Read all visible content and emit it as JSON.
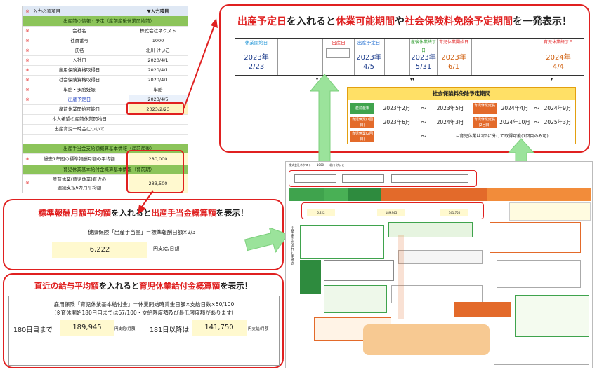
{
  "form": {
    "header": {
      "mark": "※",
      "label": "入力必須項目",
      "value": "▼入力項目"
    },
    "section1": "出産前の情報・予定（産前産後休業開始前）",
    "rows": [
      {
        "mark": "※",
        "label": "会社名",
        "value": "株式会社ネクスト"
      },
      {
        "mark": "※",
        "label": "社員番号",
        "value": "1000"
      },
      {
        "mark": "※",
        "label": "氏名",
        "value": "北川 けいこ"
      },
      {
        "mark": "※",
        "label": "入社日",
        "value": "2020/4/1"
      },
      {
        "mark": "※",
        "label": "雇用保険資格取得日",
        "value": "2020/4/1"
      },
      {
        "mark": "※",
        "label": "社会保険資格取得日",
        "value": "2020/4/1"
      },
      {
        "mark": "※",
        "label": "単胎・多胎妊娠",
        "value": "単胎"
      },
      {
        "mark": "※",
        "label": "出産予定日",
        "value": "2023/4/5"
      },
      {
        "mark": "",
        "label": "産前休業開始可能日",
        "value": "2023/2/23"
      },
      {
        "mark": "",
        "label": "本人希望の産前休業開始日",
        "value": ""
      },
      {
        "mark": "",
        "label": "出産育児一時金について",
        "value": ""
      }
    ],
    "section2": "出産手当金支給額概算基本情報（産前産後）",
    "row_std": {
      "mark": "※",
      "label": "過去1年間の標準報酬月額の平均額",
      "value": "280,000"
    },
    "section3": "育児休業基本給付金概算基本情報（育前期）",
    "row_wage": {
      "mark": "※",
      "label": "産前休業(育児休業)直近の\n連続支払6カ月平均額",
      "value": "283,500"
    }
  },
  "top_panel": {
    "title_red1": "出産予定日",
    "title_blk1": "を入れると",
    "title_red2": "休業可能期間",
    "title_blk2": "や",
    "title_red3": "社会保険料免除予定期間",
    "title_blk3": "を一発表示！",
    "cells": [
      {
        "head": "休業開始日",
        "year": "2023年",
        "date": "2/23"
      },
      {
        "head": "出産日",
        "year": "",
        "date": ""
      },
      {
        "head": "出産予定日",
        "year": "2023年",
        "date": "4/5"
      },
      {
        "head": "産後休業終了日",
        "year": "2023年",
        "date": "5/31"
      },
      {
        "head": "育児休業開始日",
        "year": "2023年",
        "date": "6/1"
      },
      {
        "head": "育児休業終了日",
        "year": "2024年",
        "date": "4/4"
      }
    ]
  },
  "social": {
    "title": "社会保険料免除予定期間",
    "rows": [
      {
        "tag": "産前産後",
        "from": "2023年2月",
        "tilde": "～",
        "to": "2023年5月",
        "tag2": "育児休業延長",
        "from2": "2024年4月",
        "tilde2": "～",
        "to2": "2024年9月"
      },
      {
        "tag": "育児休業(1回目)",
        "from": "2023年6月",
        "tilde": "～",
        "to": "2024年3月",
        "tag2": "育児休業延長(2回目)",
        "from2": "2024年10月",
        "tilde2": "～",
        "to2": "2025年3月"
      },
      {
        "tag": "育児休業(2回目)",
        "from": "",
        "tilde": "～",
        "note": "←育児休業は2回に分けて取得可能(1回目のみ可)"
      }
    ]
  },
  "left1": {
    "title_red1": "標準報酬月額平均額",
    "title_blk1": "を入れると",
    "title_red2": "出産手当金概算額",
    "title_blk2": "を表示！",
    "formula": "健康保険「出産手当金」＝標準報酬日額×2/3",
    "value": "6,222",
    "unit": "円支給/日額"
  },
  "left2": {
    "title_red1": "直近の給与平均額",
    "title_blk1": "を入れると",
    "title_red2": "育児休業給付金概算額",
    "title_blk2": "を表示！",
    "formula1": "雇用保険「育児休業基本給付金」＝休業開始時賃金日額×支給日数×50/100",
    "formula2": "（※育休開始180日目までは67/100・支給限度額及び最低限度額があります）",
    "label1": "180日目まで",
    "value1": "189,945",
    "unit1": "円支給/月額",
    "label2": "181日以降は",
    "value2": "141,750",
    "unit2": "円支給/月額"
  },
  "thumb": {
    "company": "株式会社ネクスト",
    "emp_no": "1000",
    "name": "北川 けいこ",
    "vals": [
      "6,222",
      "189,945",
      "141,750"
    ],
    "side_text": "出産までの流れと手続き",
    "items": [
      "産前産後休業の申出",
      "育児休業の申出",
      "出産手当金の申請",
      "育児休業給付金の申請",
      "社会保険料免除の申出"
    ]
  },
  "colors": {
    "accent": "#e02020",
    "green": "#8cc45a",
    "arrow": "#9be39b",
    "yellow": "#fff9cf"
  }
}
